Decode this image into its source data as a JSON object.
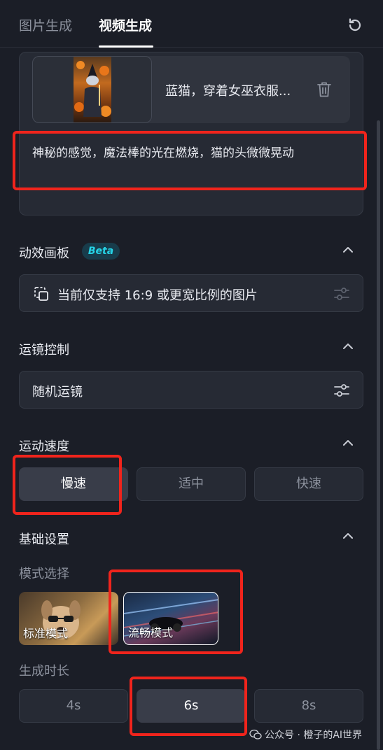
{
  "tabs": [
    {
      "label": "图片生成"
    },
    {
      "label": "视频生成"
    }
  ],
  "image_item": {
    "title": "蓝猫，穿着女巫衣服..."
  },
  "prompt": {
    "text": "神秘的感觉，魔法棒的光在燃烧，猫的头微微晃动"
  },
  "motion_board": {
    "title": "动效画板",
    "badge": "Beta",
    "notice": "当前仅支持 16:9 或更宽比例的图片"
  },
  "camera": {
    "title": "运镜控制",
    "value": "随机运镜"
  },
  "speed": {
    "title": "运动速度",
    "options": [
      {
        "label": "慢速",
        "selected": true
      },
      {
        "label": "适中",
        "selected": false
      },
      {
        "label": "快速",
        "selected": false
      }
    ]
  },
  "basic": {
    "title": "基础设置",
    "mode_label": "模式选择",
    "modes": [
      {
        "label": "标准模式",
        "selected": false
      },
      {
        "label": "流畅模式",
        "selected": true
      }
    ],
    "duration_label": "生成时长",
    "durations": [
      {
        "label": "4s",
        "selected": false
      },
      {
        "label": "6s",
        "selected": true
      },
      {
        "label": "8s",
        "selected": false
      }
    ]
  },
  "watermark": {
    "text": "公众号 · 橙子的AI世界"
  },
  "colors": {
    "highlight": "#f0241c",
    "accent": "#26d3e6",
    "background": "#1b1e27"
  }
}
